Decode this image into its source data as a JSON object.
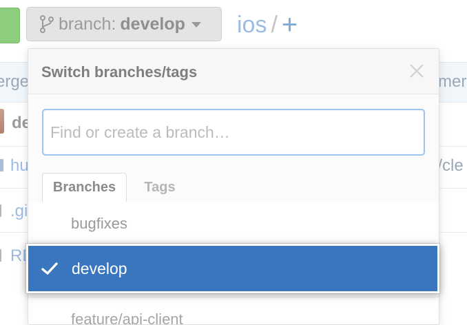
{
  "branch_select": {
    "prefix": "branch:",
    "current": "develop",
    "icon": "git-branch-icon"
  },
  "repo": {
    "name": "ios",
    "separator": "/",
    "add": "+"
  },
  "background": {
    "header_left_fragment": "erge",
    "header_right_fragment": "mer",
    "row1_text": "de",
    "row2_text": "hu",
    "row2_right": "e/cle",
    "row3_text": ".gi",
    "row4_text": "RE"
  },
  "dropdown": {
    "title": "Switch branches/tags",
    "close_icon": "close-icon",
    "filter_placeholder": "Find or create a branch…",
    "tabs": [
      {
        "label": "Branches",
        "active": true
      },
      {
        "label": "Tags",
        "active": false
      }
    ],
    "items": [
      {
        "label": "bugfixes",
        "selected": false
      },
      {
        "label": "develop",
        "selected": true
      },
      {
        "label": "feature/api-client",
        "selected": false
      }
    ]
  },
  "colors": {
    "selected_bg": "#3a76be",
    "link": "#8fb2de",
    "focus_border": "#9cc6ee"
  }
}
